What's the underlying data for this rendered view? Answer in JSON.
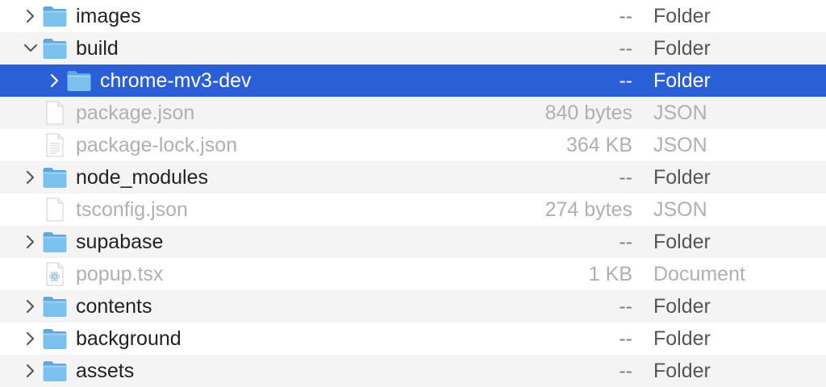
{
  "colors": {
    "selection": "#2a5fd7",
    "folder_body": "#7cc1ee",
    "folder_tab": "#5aa9e2",
    "dim_text": "#b0b0b0",
    "stripe": "#f4f4f5"
  },
  "rows": [
    {
      "name": "images",
      "size": "--",
      "kind": "Folder",
      "type": "folder",
      "level": 0,
      "disclosure": "closed",
      "selected": false,
      "dim": false,
      "icon": "folder-icon"
    },
    {
      "name": "build",
      "size": "--",
      "kind": "Folder",
      "type": "folder",
      "level": 0,
      "disclosure": "open",
      "selected": false,
      "dim": false,
      "icon": "folder-icon"
    },
    {
      "name": "chrome-mv3-dev",
      "size": "--",
      "kind": "Folder",
      "type": "folder",
      "level": 1,
      "disclosure": "closed",
      "selected": true,
      "dim": false,
      "icon": "folder-icon"
    },
    {
      "name": "package.json",
      "size": "840 bytes",
      "kind": "JSON",
      "type": "file",
      "level": 0,
      "disclosure": "none",
      "selected": false,
      "dim": true,
      "icon": "document-icon"
    },
    {
      "name": "package-lock.json",
      "size": "364 KB",
      "kind": "JSON",
      "type": "file-lines",
      "level": 0,
      "disclosure": "none",
      "selected": false,
      "dim": true,
      "icon": "text-document-icon"
    },
    {
      "name": "node_modules",
      "size": "--",
      "kind": "Folder",
      "type": "folder",
      "level": 0,
      "disclosure": "closed",
      "selected": false,
      "dim": false,
      "icon": "folder-icon"
    },
    {
      "name": "tsconfig.json",
      "size": "274 bytes",
      "kind": "JSON",
      "type": "file",
      "level": 0,
      "disclosure": "none",
      "selected": false,
      "dim": true,
      "icon": "document-icon"
    },
    {
      "name": "supabase",
      "size": "--",
      "kind": "Folder",
      "type": "folder",
      "level": 0,
      "disclosure": "closed",
      "selected": false,
      "dim": false,
      "icon": "folder-icon"
    },
    {
      "name": "popup.tsx",
      "size": "1 KB",
      "kind": "Document",
      "type": "file-react",
      "level": 0,
      "disclosure": "none",
      "selected": false,
      "dim": true,
      "icon": "react-document-icon"
    },
    {
      "name": "contents",
      "size": "--",
      "kind": "Folder",
      "type": "folder",
      "level": 0,
      "disclosure": "closed",
      "selected": false,
      "dim": false,
      "icon": "folder-icon"
    },
    {
      "name": "background",
      "size": "--",
      "kind": "Folder",
      "type": "folder",
      "level": 0,
      "disclosure": "closed",
      "selected": false,
      "dim": false,
      "icon": "folder-icon"
    },
    {
      "name": "assets",
      "size": "--",
      "kind": "Folder",
      "type": "folder",
      "level": 0,
      "disclosure": "closed",
      "selected": false,
      "dim": false,
      "icon": "folder-icon"
    }
  ]
}
